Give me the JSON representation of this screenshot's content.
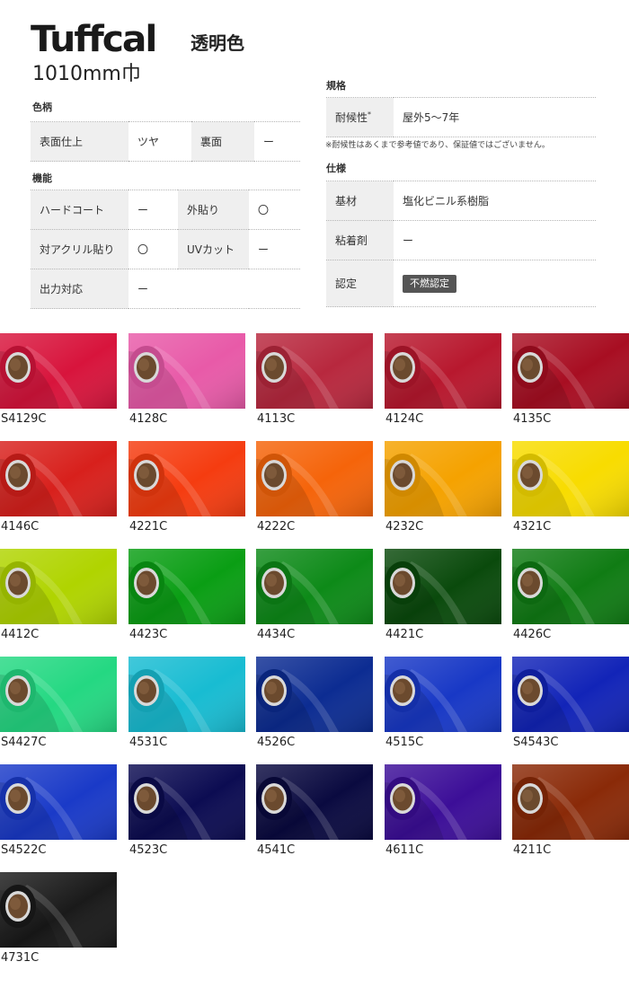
{
  "header": {
    "brand": "Tuffcal",
    "subtitle": "透明色",
    "width": "1010mm巾"
  },
  "sections": {
    "pattern_title": "色柄",
    "function_title": "機能",
    "standard_title": "規格",
    "spec_title": "仕様"
  },
  "pattern": {
    "surface_label": "表面仕上",
    "surface_value": "ツヤ",
    "back_label": "裏面",
    "back_value": "ー"
  },
  "function": {
    "hardcoat_label": "ハードコート",
    "hardcoat_value": "ー",
    "outdoor_label": "外貼り",
    "outdoor_value": "〇",
    "acrylic_label": "対アクリル貼り",
    "acrylic_value": "〇",
    "uvcut_label": "UVカット",
    "uvcut_value": "ー",
    "output_label": "出力対応",
    "output_value": "ー"
  },
  "standard": {
    "weather_label": "耐候性",
    "weather_mark": "*",
    "weather_value": "屋外5～7年",
    "note": "※耐候性はあくまで参考値であり、保証値ではございません。"
  },
  "spec": {
    "base_label": "基材",
    "base_value": "塩化ビニル系樹脂",
    "adhesive_label": "粘着剤",
    "adhesive_value": "ー",
    "cert_label": "認定",
    "cert_value": "不燃認定"
  },
  "swatches": [
    {
      "code": "S4129C",
      "color": "#d8143c"
    },
    {
      "code": "4128C",
      "color": "#e85aa8"
    },
    {
      "code": "4113C",
      "color": "#b8283e"
    },
    {
      "code": "4124C",
      "color": "#b8182e"
    },
    {
      "code": "4135C",
      "color": "#a80e22"
    },
    {
      "code": "4146C",
      "color": "#d8201c"
    },
    {
      "code": "4221C",
      "color": "#f53c10"
    },
    {
      "code": "4222C",
      "color": "#f5640a"
    },
    {
      "code": "4232C",
      "color": "#f5a200"
    },
    {
      "code": "4321C",
      "color": "#f8dc00"
    },
    {
      "code": "4412C",
      "color": "#b0d400"
    },
    {
      "code": "4423C",
      "color": "#0a9e14"
    },
    {
      "code": "4434C",
      "color": "#0d8a18"
    },
    {
      "code": "4421C",
      "color": "#0a4a0c"
    },
    {
      "code": "4426C",
      "color": "#107c14"
    },
    {
      "code": "S4427C",
      "color": "#24d882"
    },
    {
      "code": "4531C",
      "color": "#18bcd2"
    },
    {
      "code": "4526C",
      "color": "#0c2c92"
    },
    {
      "code": "4515C",
      "color": "#1838c6"
    },
    {
      "code": "S4543C",
      "color": "#1224b8"
    },
    {
      "code": "S4522C",
      "color": "#1a3ac8"
    },
    {
      "code": "4523C",
      "color": "#0c0c52"
    },
    {
      "code": "4541C",
      "color": "#0a0a40"
    },
    {
      "code": "4611C",
      "color": "#3c0e98"
    },
    {
      "code": "4211C",
      "color": "#8a2a08"
    },
    {
      "code": "4731C",
      "color": "#1a1a1a"
    }
  ]
}
